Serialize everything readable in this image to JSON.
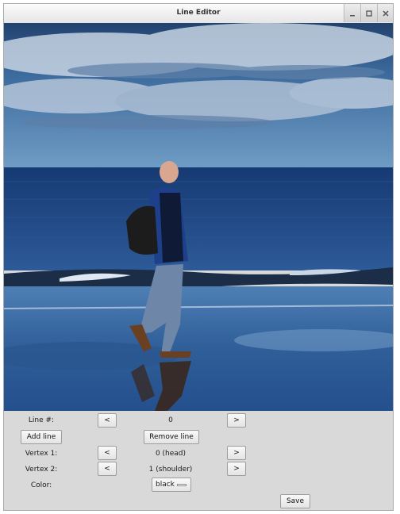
{
  "window": {
    "title": "Line Editor"
  },
  "controls": {
    "line_label": "Line #:",
    "line_prev": "<",
    "line_value": "0",
    "line_next": ">",
    "add_line": "Add line",
    "remove_line": "Remove line",
    "vertex1_label": "Vertex 1:",
    "vertex1_prev": "<",
    "vertex1_value": "0 (head)",
    "vertex1_next": ">",
    "vertex2_label": "Vertex 2:",
    "vertex2_prev": "<",
    "vertex2_value": "1 (shoulder)",
    "vertex2_next": ">",
    "color_label": "Color:",
    "color_value": "black",
    "save": "Save"
  },
  "icons": {
    "minimize": "minimize-icon",
    "maximize": "maximize-icon",
    "close": "close-icon"
  },
  "colors": {
    "sky": "#3a6a9c",
    "sea": "#1f4a86",
    "sand": "#3e6ea6",
    "panel": "#d9d9d9"
  }
}
